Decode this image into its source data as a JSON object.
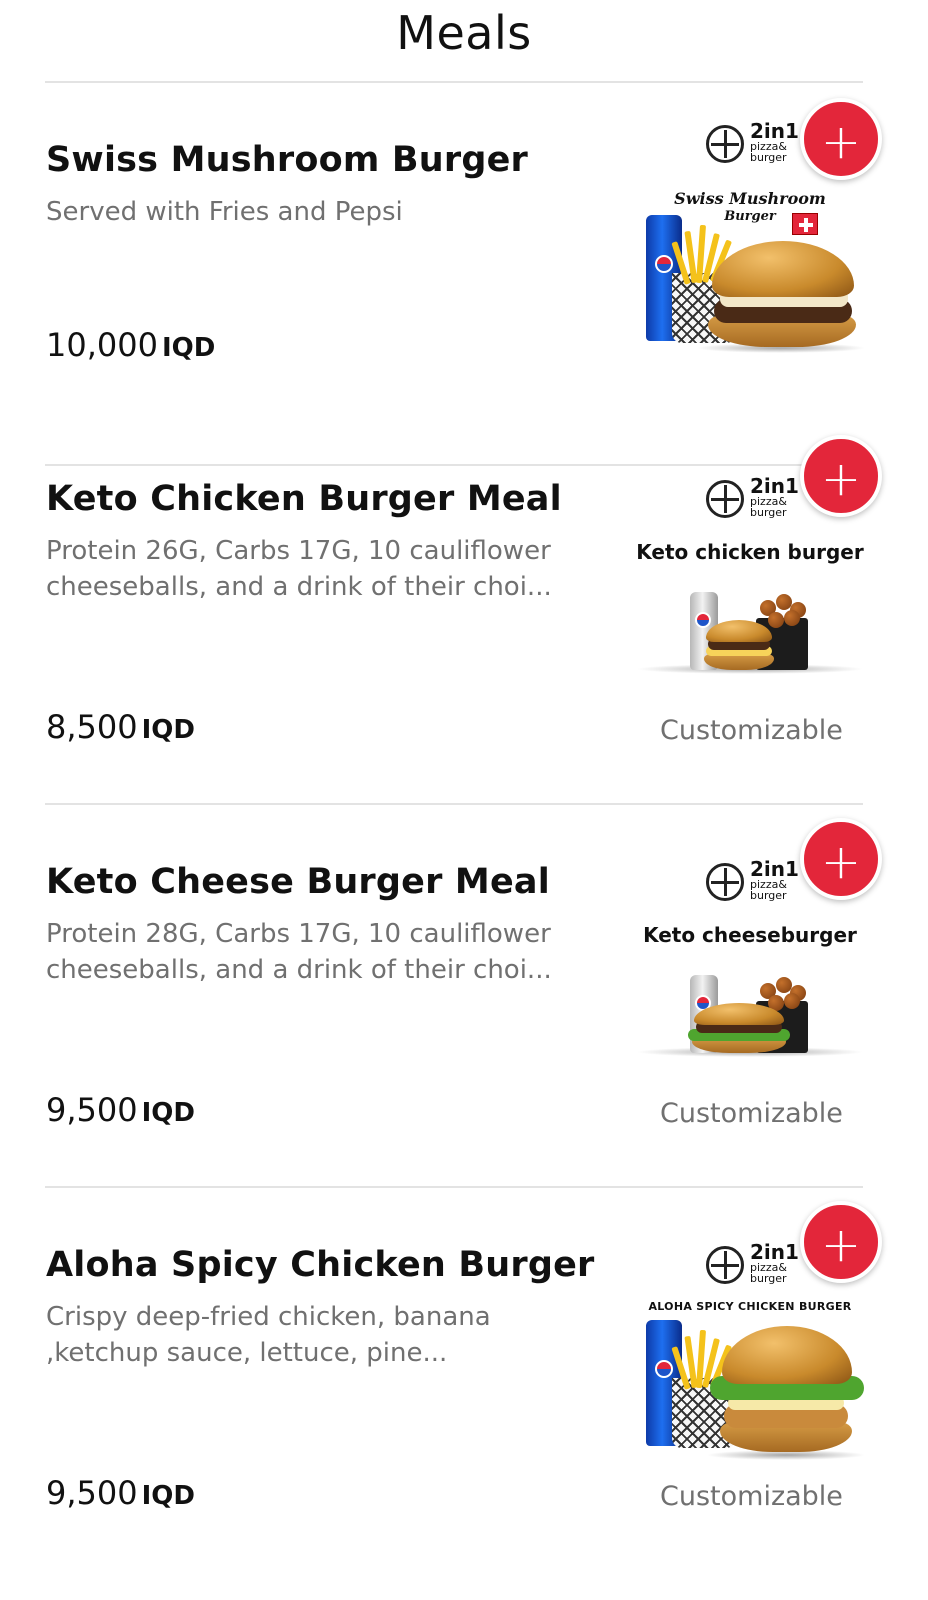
{
  "header": {
    "title": "Meals"
  },
  "currency": "IQD",
  "items": [
    {
      "name": "Swiss Mushroom Burger",
      "description": "Served with Fries and Pepsi",
      "price": "10,000",
      "customizable": "",
      "image_caption": "Swiss Mushroom",
      "image_subcaption": "Burger",
      "add_icon": "plus-icon"
    },
    {
      "name": "Keto Chicken Burger Meal",
      "description": "Protein 26G, Carbs 17G, 10 cauliflower cheeseballs, and a drink of their choi...",
      "price": "8,500",
      "customizable": "Customizable",
      "image_caption": "Keto chicken burger",
      "add_icon": "plus-icon"
    },
    {
      "name": "Keto Cheese Burger Meal",
      "description": "Protein 28G, Carbs 17G, 10 cauliflower cheeseballs, and a drink of their choi...",
      "price": "9,500",
      "customizable": "Customizable",
      "image_caption": "Keto cheeseburger",
      "add_icon": "plus-icon"
    },
    {
      "name": "Aloha Spicy Chicken Burger",
      "description": "Crispy deep-fried chicken, banana ,ketchup sauce, lettuce, pine...",
      "price": "9,500",
      "customizable": "Customizable",
      "image_caption": "ALOHA SPICY CHICKEN BURGER",
      "add_icon": "plus-icon"
    }
  ],
  "logo": {
    "big": "2in1",
    "small1": "pizza&",
    "small2": "burger"
  },
  "colors": {
    "accent": "#e3263a",
    "muted_text": "#707070",
    "divider": "#e3e3e3"
  }
}
